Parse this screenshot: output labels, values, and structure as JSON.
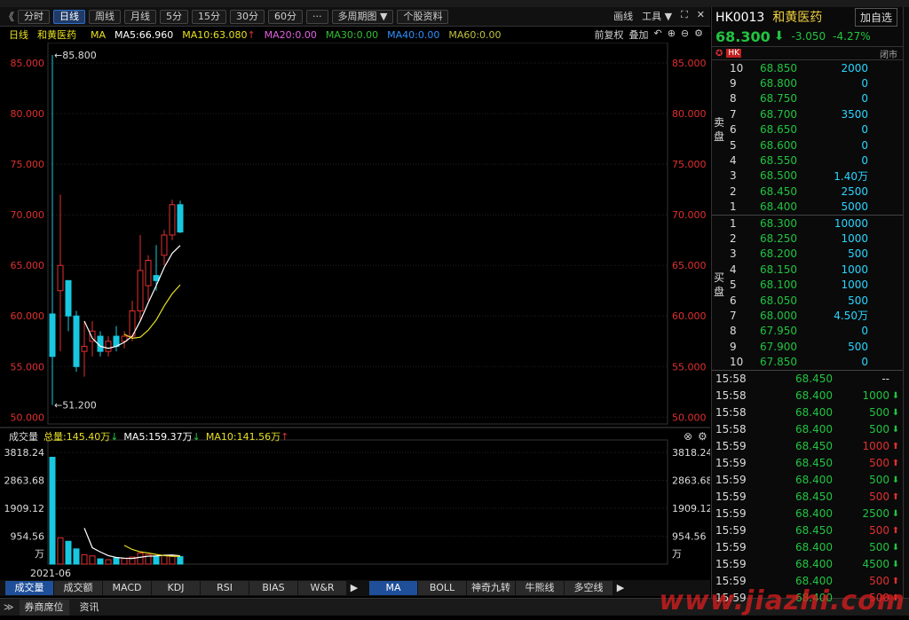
{
  "toolbar": {
    "back": "《",
    "buttons": [
      "分时",
      "日线",
      "周线",
      "月线",
      "5分",
      "15分",
      "30分",
      "60分",
      "···",
      "多周期图 ▼",
      "个股资料"
    ],
    "active_index": 1,
    "right": [
      "画线",
      "工具 ▼",
      "⛶",
      "✕"
    ]
  },
  "legend": {
    "period": "日线",
    "name": "和黄医药",
    "ma": "MA",
    "ma5": "MA5:66.960",
    "ma10": "MA10:63.080",
    "ma20": "MA20:0.00",
    "ma30": "MA30:0.00",
    "ma40": "MA40:0.00",
    "ma60": "MA60:0.00",
    "right": [
      "前复权",
      "叠加"
    ],
    "up_arrow": "↑"
  },
  "colors": {
    "up": "#e03030",
    "down": "#18c8e0",
    "ma5": "#ffffff",
    "ma10": "#e8e020",
    "ma20": "#e060e0",
    "ma30": "#30c030",
    "ma40": "#3090ff",
    "ma60": "#c0c040",
    "green": "#21c441"
  },
  "chart_data": {
    "type": "candlestick",
    "y_ticks": [
      "85.000",
      "80.000",
      "75.000",
      "70.000",
      "65.000",
      "60.000",
      "55.000",
      "50.000"
    ],
    "ylim": [
      49.5,
      86.5
    ],
    "max_label": "←85.800",
    "min_label": "←51.200",
    "volume": {
      "title": "成交量",
      "total": "总量:145.40万",
      "ma5": "MA5:159.37万",
      "ma10": "MA10:141.56万",
      "down_arrow": "↓",
      "up_arrow": "↑",
      "y_ticks": [
        "3818.24",
        "2863.68",
        "1909.12",
        "954.56"
      ],
      "unit_label": "万",
      "x_label": "2021-06",
      "ylim": [
        0,
        3818.24
      ]
    }
  },
  "candles": [
    [
      60.2,
      85.8,
      51.2,
      56.0
    ],
    [
      62.5,
      72.0,
      56.5,
      65.0
    ],
    [
      63.5,
      63.5,
      58.5,
      60.0
    ],
    [
      60.0,
      60.5,
      54.5,
      55.0
    ],
    [
      56.5,
      59.5,
      54.0,
      57.0
    ],
    [
      57.5,
      59.5,
      56.0,
      58.5
    ],
    [
      58.0,
      58.5,
      56.0,
      56.5
    ],
    [
      56.5,
      58.0,
      56.0,
      57.5
    ],
    [
      58.0,
      59.0,
      56.5,
      57.0
    ],
    [
      57.5,
      58.5,
      56.8,
      58.0
    ],
    [
      58.0,
      61.5,
      57.5,
      60.5
    ],
    [
      60.5,
      68.0,
      59.5,
      64.5
    ],
    [
      63.0,
      66.0,
      61.5,
      65.5
    ],
    [
      64.0,
      67.0,
      62.5,
      63.5
    ],
    [
      66.0,
      68.5,
      65.0,
      68.0
    ],
    [
      68.0,
      71.5,
      67.5,
      71.0
    ],
    [
      71.0,
      71.4,
      68.2,
      68.3
    ]
  ],
  "ma5_line": [
    null,
    null,
    null,
    null,
    59.5,
    57.8,
    57.0,
    56.8,
    57.0,
    57.4,
    58.0,
    59.5,
    61.3,
    63.0,
    64.8,
    66.2,
    66.96
  ],
  "ma10_line": [
    null,
    null,
    null,
    null,
    null,
    null,
    null,
    null,
    null,
    58.2,
    57.8,
    57.9,
    58.6,
    59.6,
    61.0,
    62.2,
    63.08
  ],
  "volumes": [
    3650,
    900,
    780,
    520,
    320,
    280,
    180,
    150,
    210,
    190,
    240,
    380,
    330,
    260,
    300,
    280,
    260
  ],
  "vol_ma5": [
    null,
    null,
    null,
    null,
    1230,
    560,
    416,
    290,
    228,
    202,
    194,
    234,
    270,
    280,
    302,
    310,
    286
  ],
  "vol_ma10": [
    null,
    null,
    null,
    null,
    null,
    null,
    null,
    null,
    null,
    640,
    500,
    420,
    380,
    330,
    290,
    270,
    265
  ],
  "bottom_tabs": [
    "成交量",
    "成交额",
    "MACD",
    "KDJ",
    "RSI",
    "BIAS",
    "W&R",
    "▶",
    "MA",
    "BOLL",
    "神奇九转",
    "牛熊线",
    "多空线",
    "▶"
  ],
  "footer": {
    "toggle": "≫",
    "tabs": [
      "券商席位",
      "资讯"
    ]
  },
  "quote": {
    "code": "HK0013",
    "name": "和黄医药",
    "add_button": "加自选",
    "price": "68.300",
    "arrow": "⬇",
    "change": "-3.050",
    "pct": "-4.27%",
    "market_tag": "HK",
    "status": "闭市",
    "sell_label": "卖盘",
    "buy_label": "买盘"
  },
  "asks": [
    [
      "10",
      "68.850",
      "2000"
    ],
    [
      "9",
      "68.800",
      "0"
    ],
    [
      "8",
      "68.750",
      "0"
    ],
    [
      "7",
      "68.700",
      "3500"
    ],
    [
      "6",
      "68.650",
      "0"
    ],
    [
      "5",
      "68.600",
      "0"
    ],
    [
      "4",
      "68.550",
      "0"
    ],
    [
      "3",
      "68.500",
      "1.40万"
    ],
    [
      "2",
      "68.450",
      "2500"
    ],
    [
      "1",
      "68.400",
      "5000"
    ]
  ],
  "bids": [
    [
      "1",
      "68.300",
      "10000"
    ],
    [
      "2",
      "68.250",
      "1000"
    ],
    [
      "3",
      "68.200",
      "500"
    ],
    [
      "4",
      "68.150",
      "1000"
    ],
    [
      "5",
      "68.100",
      "1000"
    ],
    [
      "6",
      "68.050",
      "500"
    ],
    [
      "7",
      "68.000",
      "4.50万"
    ],
    [
      "8",
      "67.950",
      "0"
    ],
    [
      "9",
      "67.900",
      "500"
    ],
    [
      "10",
      "67.850",
      "0"
    ]
  ],
  "ticks": [
    [
      "15:58",
      "68.450",
      "--",
      ""
    ],
    [
      "15:58",
      "68.400",
      "1000",
      "down"
    ],
    [
      "15:58",
      "68.400",
      "500",
      "down"
    ],
    [
      "15:58",
      "68.400",
      "500",
      "down"
    ],
    [
      "15:59",
      "68.450",
      "1000",
      "up"
    ],
    [
      "15:59",
      "68.450",
      "500",
      "up"
    ],
    [
      "15:59",
      "68.400",
      "500",
      "down"
    ],
    [
      "15:59",
      "68.450",
      "500",
      "up"
    ],
    [
      "15:59",
      "68.400",
      "2500",
      "down"
    ],
    [
      "15:59",
      "68.450",
      "500",
      "up"
    ],
    [
      "15:59",
      "68.400",
      "500",
      "down"
    ],
    [
      "15:59",
      "68.400",
      "4500",
      "down"
    ],
    [
      "15:59",
      "68.400",
      "500",
      "up"
    ],
    [
      "15:59",
      "68.400",
      "500",
      "up"
    ]
  ],
  "watermark": "www.jiazhi.com"
}
